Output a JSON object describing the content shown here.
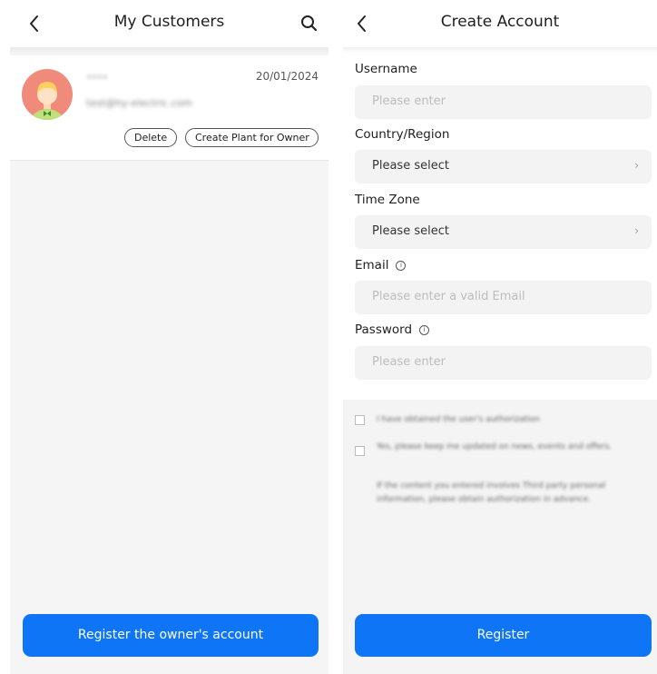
{
  "customers_screen": {
    "title": "My Customers",
    "customers": [
      {
        "name": "••••",
        "email": "test@hy-electric.com",
        "date": "20/01/2024",
        "delete_label": "Delete",
        "create_plant_label": "Create Plant for Owner"
      }
    ],
    "register_button": "Register the owner's account"
  },
  "create_account_screen": {
    "title": "Create Account",
    "fields": {
      "username": {
        "label": "Username",
        "placeholder": "Please enter"
      },
      "country": {
        "label": "Country/Region",
        "value": "Please select"
      },
      "timezone": {
        "label": "Time Zone",
        "value": "Please select"
      },
      "email": {
        "label": "Email",
        "placeholder": "Please enter a valid Email"
      },
      "password": {
        "label": "Password",
        "placeholder": "Please enter"
      }
    },
    "consent": {
      "authorization": "I have obtained the user's authorization",
      "updates": "Yes, please keep me updated on news, events and offers.",
      "note": "If the content you entered involves Third party personal information, please obtain authorization in advance."
    },
    "register_button": "Register"
  },
  "colors": {
    "primary": "#0d75f6",
    "avatar_bg": "#f08a7a"
  },
  "icons": [
    "back-icon",
    "search-icon",
    "info-icon",
    "chevron-right-icon",
    "avatar-icon"
  ]
}
